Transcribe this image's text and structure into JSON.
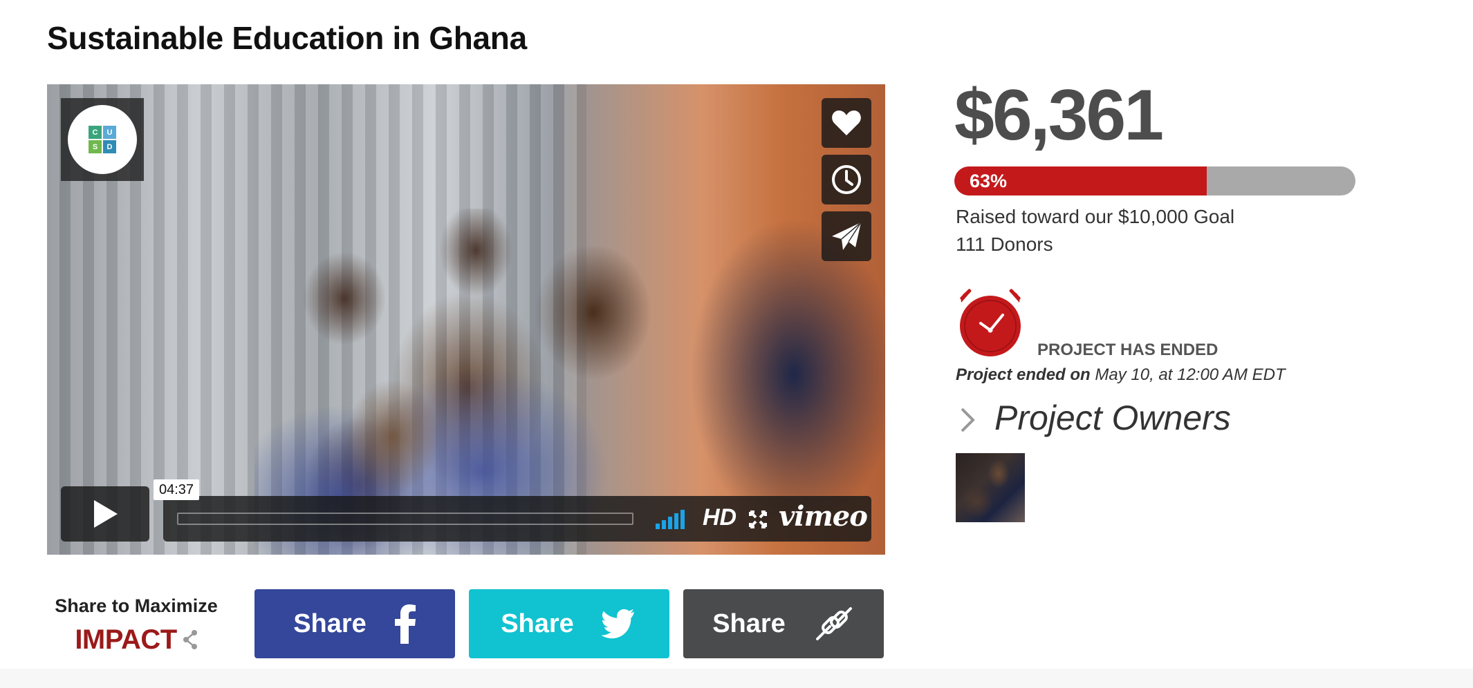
{
  "page": {
    "title": "Sustainable Education in Ghana"
  },
  "video": {
    "logo_letters": [
      "C",
      "U",
      "S",
      "D"
    ],
    "logo_colors": [
      "#3aa57d",
      "#5aaad6",
      "#6fb84e",
      "#2f8cb5"
    ],
    "side_actions": [
      {
        "name": "like-button",
        "icon": "heart-icon"
      },
      {
        "name": "watch-later-button",
        "icon": "clock-icon"
      },
      {
        "name": "share-video-button",
        "icon": "paper-plane-icon"
      }
    ],
    "duration": "04:37",
    "progress": 0,
    "volume_icon": "volume-bars-icon",
    "hd_label": "HD",
    "fullscreen_icon": "fullscreen-icon",
    "brand": "vimeo"
  },
  "share": {
    "label": "Share to Maximize",
    "impact": "IMPACT",
    "buttons": [
      {
        "label": "Share",
        "icon": "facebook-icon",
        "color": "#34479a"
      },
      {
        "label": "Share",
        "icon": "twitter-icon",
        "color": "#11c2d0"
      },
      {
        "label": "Share",
        "icon": "link-icon",
        "color": "#4a4b4d"
      }
    ]
  },
  "funding": {
    "amount": "$6,361",
    "percent_label": "63%",
    "percent": 63,
    "goal_text": "Raised toward our $10,000 Goal",
    "donors": "111 Donors",
    "accent": "#c4191b"
  },
  "status": {
    "clock_icon": "alarm-clock-icon",
    "label": "PROJECT HAS ENDED",
    "ended_prefix": "Project ended on",
    "ended_date": "May 10, at 12:00 AM EDT"
  },
  "owners": {
    "title": "Project Owners"
  }
}
